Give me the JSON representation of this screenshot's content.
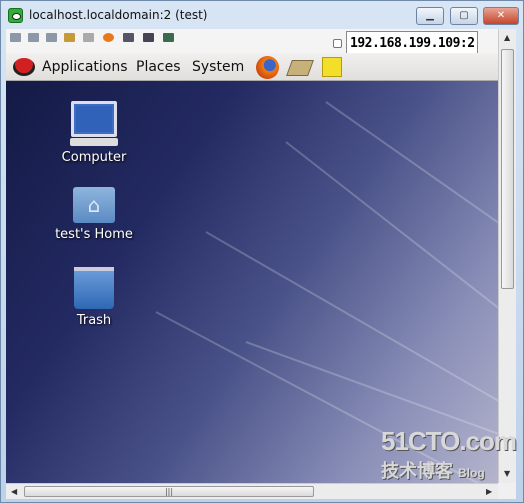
{
  "window": {
    "title": "localhost.localdomain:2 (test)",
    "minimize_icon": "minimize-icon",
    "maximize_icon": "maximize-icon",
    "close_icon": "close-icon"
  },
  "toolbar": {
    "address": "192.168.199.109:2",
    "icons": [
      "options-icon",
      "connection-info-icon",
      "refresh-icon",
      "send-ctrl-alt-del-icon",
      "clipboard-icon",
      "file-transfer-icon",
      "chat-icon",
      "fullscreen-icon",
      "exit-icon"
    ]
  },
  "panel": {
    "applications": "Applications",
    "places": "Places",
    "system": "System",
    "launchers": [
      "firefox-icon",
      "screenshot-icon",
      "notes-icon"
    ]
  },
  "desktop": {
    "icons": [
      {
        "label": "Computer"
      },
      {
        "label": "test's Home"
      },
      {
        "label": "Trash"
      }
    ]
  },
  "watermark": {
    "brand": "51CTO.com",
    "sub": "技术博客",
    "blog": "Blog"
  }
}
